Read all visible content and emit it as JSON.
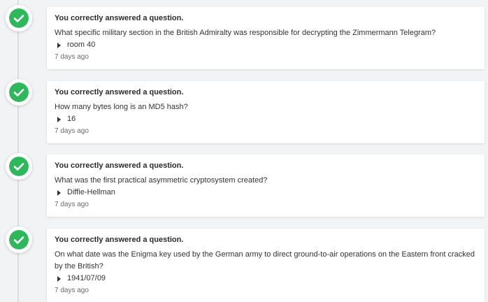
{
  "theme": {
    "accent_green": "#2eb85c",
    "badge_icon": "check-icon"
  },
  "entries": [
    {
      "title": "You correctly answered a question.",
      "question": "What specific military section in the British Admiralty was responsible for decrypting the Zimmermann Telegram?",
      "answer": "room 40",
      "time": "7 days ago"
    },
    {
      "title": "You correctly answered a question.",
      "question": "How many bytes long is an MD5 hash?",
      "answer": "16",
      "time": "7 days ago"
    },
    {
      "title": "You correctly answered a question.",
      "question": "What was the first practical asymmetric cryptosystem created?",
      "answer": "Diffie-Hellman",
      "time": "7 days ago"
    },
    {
      "title": "You correctly answered a question.",
      "question": "On what date was the Enigma key used by the German army to direct ground-to-air operations on the Eastern front cracked by the British?",
      "answer": "1941/07/09",
      "time": "7 days ago"
    }
  ]
}
